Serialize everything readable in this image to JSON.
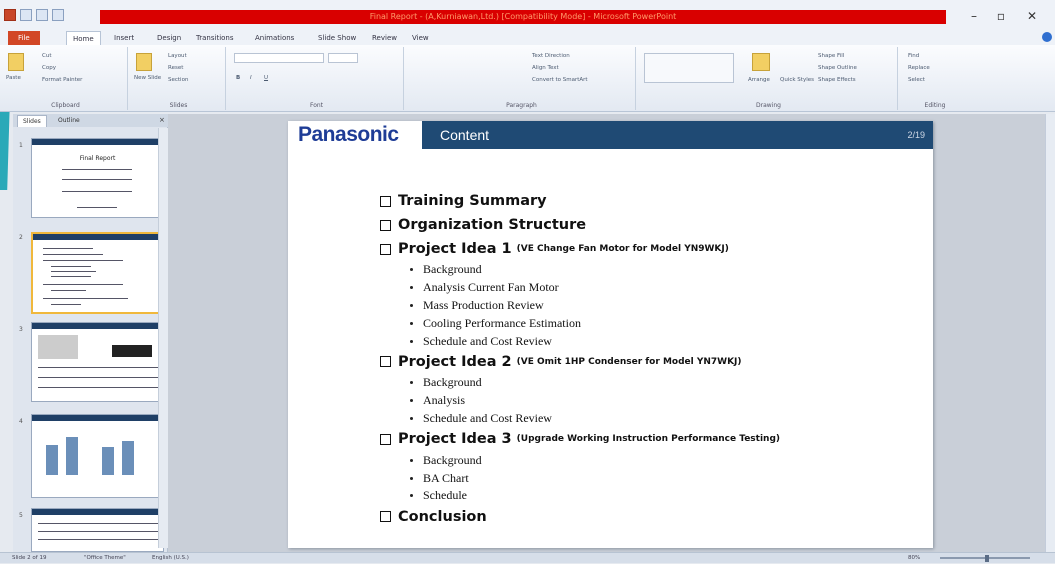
{
  "window": {
    "title": "Final Report - (A,Kurniawan,Ltd.) [Compatibility Mode] - Microsoft PowerPoint",
    "minimize": "–",
    "maximize": "▫",
    "close": "✕"
  },
  "ribbon_tabs": [
    "File",
    "Home",
    "Insert",
    "Design",
    "Transitions",
    "Animations",
    "Slide Show",
    "Review",
    "View"
  ],
  "ribbon": {
    "clipboard": {
      "label": "Clipboard",
      "paste": "Paste",
      "cut": "Cut",
      "copy": "Copy",
      "format_painter": "Format Painter"
    },
    "slides": {
      "label": "Slides",
      "new_slide": "New Slide",
      "layout": "Layout",
      "reset": "Reset",
      "section": "Section"
    },
    "font": {
      "label": "Font",
      "bold": "B",
      "italic": "I",
      "underline": "U"
    },
    "paragraph": {
      "label": "Paragraph",
      "text_direction": "Text Direction",
      "align_text": "Align Text",
      "smartart": "Convert to SmartArt"
    },
    "drawing": {
      "label": "Drawing",
      "arrange": "Arrange",
      "quick_styles": "Quick Styles",
      "shape_fill": "Shape Fill",
      "shape_outline": "Shape Outline",
      "shape_effects": "Shape Effects"
    },
    "editing": {
      "label": "Editing",
      "find": "Find",
      "replace": "Replace",
      "select": "Select"
    }
  },
  "left_pane": {
    "tabs": [
      "Slides",
      "Outline"
    ],
    "thumb_numbers": [
      "1",
      "2",
      "3",
      "4",
      "5"
    ],
    "thumb1_title": "Final Report"
  },
  "slide": {
    "brand": "Panasonic",
    "header_title": "Content",
    "page_number": "2/19",
    "items": [
      {
        "type": "main",
        "text": "Training Summary",
        "sub": ""
      },
      {
        "type": "main",
        "text": "Organization Structure",
        "sub": ""
      },
      {
        "type": "main",
        "text": "Project Idea 1",
        "sub": "(VE Change Fan Motor for Model YN9WKJ)"
      },
      {
        "type": "bullet",
        "text": "Background"
      },
      {
        "type": "bullet",
        "text": "Analysis Current Fan Motor"
      },
      {
        "type": "bullet",
        "text": "Mass Production Review"
      },
      {
        "type": "bullet",
        "text": "Cooling Performance Estimation"
      },
      {
        "type": "bullet",
        "text": "Schedule and Cost Review"
      },
      {
        "type": "main",
        "text": "Project Idea 2",
        "sub": "(VE Omit 1HP Condenser for Model YN7WKJ)"
      },
      {
        "type": "bullet",
        "text": "Background"
      },
      {
        "type": "bullet",
        "text": "Analysis"
      },
      {
        "type": "bullet",
        "text": "Schedule and Cost Review"
      },
      {
        "type": "main",
        "text": "Project Idea 3",
        "sub": "(Upgrade Working Instruction Performance Testing)"
      },
      {
        "type": "bullet",
        "text": "Background"
      },
      {
        "type": "bullet",
        "text": "BA Chart"
      },
      {
        "type": "bullet",
        "text": "Schedule"
      },
      {
        "type": "main",
        "text": "Conclusion",
        "sub": ""
      }
    ]
  },
  "status_bar": {
    "slide_info": "Slide 2 of 19",
    "theme": "\"Office Theme\"",
    "language": "English (U.S.)",
    "zoom": "80%"
  },
  "colors": {
    "title_band": "#d90000",
    "header_band": "#1f4a74",
    "brand": "#1e3c96",
    "file_tab": "#d24726"
  }
}
